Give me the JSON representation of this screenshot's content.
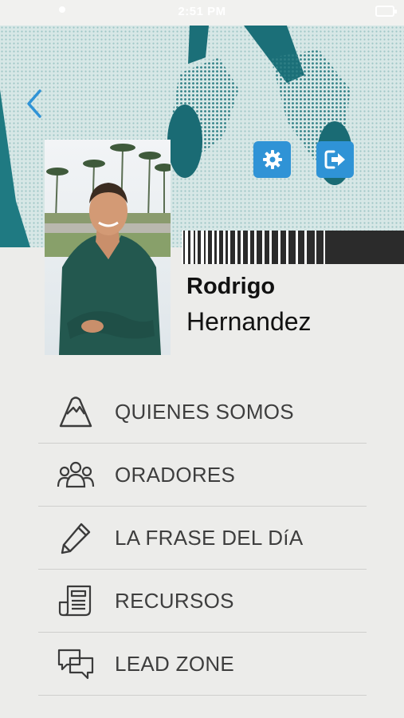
{
  "status_bar": {
    "time": "2:51 PM"
  },
  "header": {
    "back_icon": "chevron-left-icon",
    "settings_icon": "gear-icon",
    "logout_icon": "logout-icon",
    "accent_color": "#2f93d6"
  },
  "profile": {
    "first_name": "Rodrigo",
    "last_name": "Hernandez"
  },
  "menu": {
    "items": [
      {
        "label": "QUIENES SOMOS",
        "icon": "mountain-icon"
      },
      {
        "label": "ORADORES",
        "icon": "people-icon"
      },
      {
        "label": "LA FRASE DEL DíA",
        "icon": "pen-icon"
      },
      {
        "label": "RECURSOS",
        "icon": "document-icon"
      },
      {
        "label": "LEAD ZONE",
        "icon": "chat-icon"
      }
    ]
  }
}
